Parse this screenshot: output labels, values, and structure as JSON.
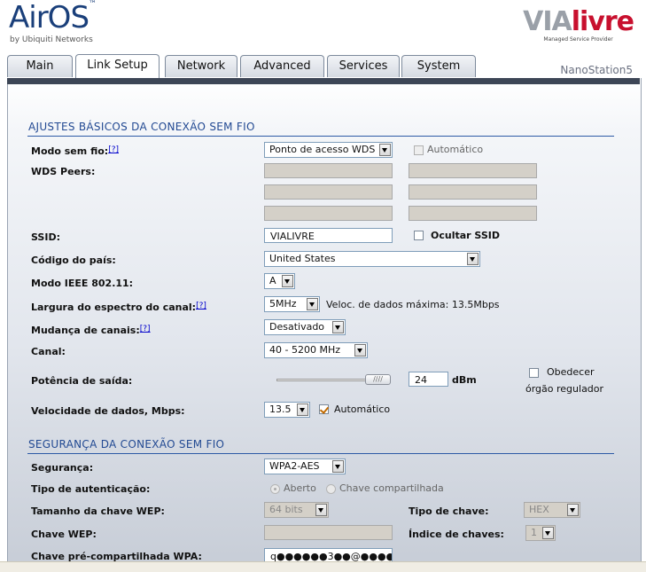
{
  "header": {
    "logo_main": "AirOS",
    "logo_trademark": "™",
    "logo_sub": "by Ubiquiti Networks",
    "partner_logo_via": "VIA",
    "partner_logo_livre": "livre",
    "partner_logo_sub": "Managed Service Provider"
  },
  "tabs": [
    {
      "label": "Main"
    },
    {
      "label": "Link Setup"
    },
    {
      "label": "Network"
    },
    {
      "label": "Advanced"
    },
    {
      "label": "Services"
    },
    {
      "label": "System"
    }
  ],
  "active_tab": "Link Setup",
  "device_name": "NanoStation5",
  "help_marker": "[?]",
  "wireless": {
    "section_title": "AJUSTES BÁSICOS DA CONEXÃO SEM FIO",
    "mode_label": "Modo sem fio:",
    "mode_value": "Ponto de acesso WDS",
    "auto_label": "Automático",
    "wds_label": "WDS Peers:",
    "ssid_label": "SSID:",
    "ssid_value": "VIALIVRE",
    "hide_ssid_label": "Ocultar SSID",
    "country_label": "Código do país:",
    "country_value": "United States",
    "ieee_label": "Modo IEEE 802.11:",
    "ieee_value": "A",
    "width_label": "Largura do espectro do canal:",
    "width_value": "5MHz",
    "max_rate_text": "Veloc. de dados máxima: 13.5Mbps",
    "shift_label": "Mudança de canais:",
    "shift_value": "Desativado",
    "channel_label": "Canal:",
    "channel_value": "40 - 5200 MHz",
    "power_label": "Potência de saída:",
    "power_value": "24",
    "power_unit": "dBm",
    "obey_label_1": "Obedecer",
    "obey_label_2": "órgão regulador",
    "rate_label": "Velocidade de dados, Mbps:",
    "rate_value": "13.5",
    "rate_auto_label": "Automático"
  },
  "security": {
    "section_title": "SEGURANÇA DA CONEXÃO SEM FIO",
    "security_label": "Segurança:",
    "security_value": "WPA2-AES",
    "auth_label": "Tipo de autenticação:",
    "auth_open": "Aberto",
    "auth_shared": "Chave compartilhada",
    "wep_len_label": "Tamanho da chave WEP:",
    "wep_len_value": "64 bits",
    "key_type_label": "Tipo de chave:",
    "key_type_value": "HEX",
    "wep_key_label": "Chave WEP:",
    "key_index_label": "Índice de chaves:",
    "key_index_value": "1",
    "wpa_key_label": "Chave pré-compartilhada WPA:",
    "wpa_key_value": "q●●●●●●3●●@●●●●●"
  },
  "colors": {
    "section_blue": "#234a93",
    "logo_blue": "#1a3f7a",
    "brand_red": "#c8102e"
  }
}
